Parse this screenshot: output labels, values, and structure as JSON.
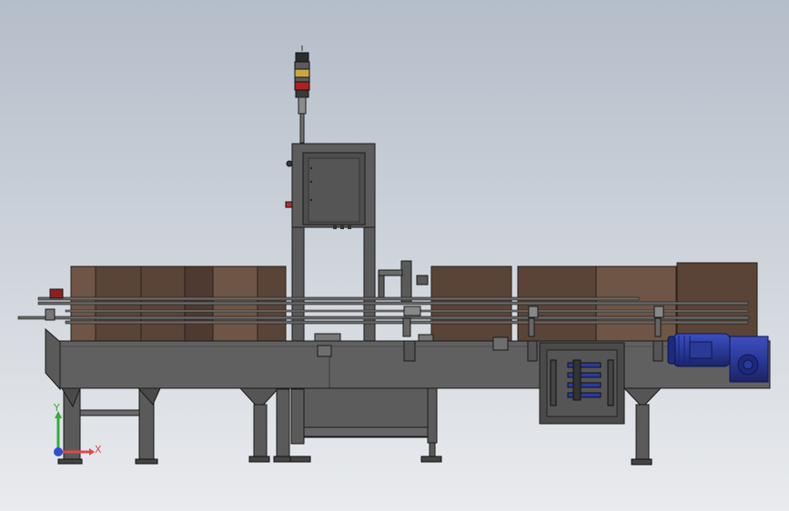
{
  "viewport": {
    "background_top": "#b4bdc9",
    "background_bottom": "#e9ebee"
  },
  "colors": {
    "steel_dark": "#3c3c3c",
    "steel_mid": "#555555",
    "steel_light": "#6a6a6a",
    "box_brown": "#5a4438",
    "box_brown_light": "#6e5546",
    "motor_blue": "#2b3a98",
    "stack_light_red": "#b02020",
    "stack_light_amber": "#c9a640",
    "outline": "#1a1a1a"
  },
  "triad": {
    "x_label": "X",
    "y_label": "Y",
    "x_color": "#e04848",
    "y_color": "#2fae3a",
    "z_color": "#3050d0"
  },
  "parts": {
    "stack_light": "stack-light-tower",
    "control_cabinet": "checkweigher-control-cabinet",
    "conveyor_frame": "main-conveyor-frame",
    "electrical_box": "electrical-junction-box",
    "drive_motor": "gear-motor-drive",
    "cartons": "carton-row"
  }
}
